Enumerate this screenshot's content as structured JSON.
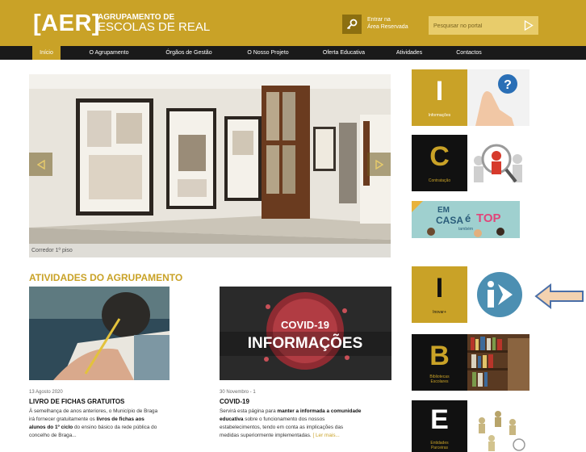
{
  "header": {
    "logo_mark": "[AER]",
    "logo_line1": "AGRUPAMENTO DE",
    "logo_line2": "ESCOLAS DE REAL",
    "reserved_line1": "Entrar na",
    "reserved_line2": "Área Reservada",
    "search_placeholder": "Pesquisar no portal",
    "colors": {
      "brand": "#c9a227",
      "nav": "#1a1a1a"
    }
  },
  "nav": {
    "items": [
      {
        "label": "Início",
        "active": true
      },
      {
        "label": "O Agrupamento"
      },
      {
        "label": "Órgãos de Gestão"
      },
      {
        "label": "O Nosso Projeto"
      },
      {
        "label": "Oferta Educativa"
      },
      {
        "label": "Atividades"
      },
      {
        "label": "Contactos"
      }
    ]
  },
  "slider": {
    "caption": "Corredor 1º piso"
  },
  "activities": {
    "title": "ATIVIDADES DO AGRUPAMENTO",
    "items": [
      {
        "date": "13 Agosto 2020",
        "title": "LIVRO DE FICHAS GRATUITOS",
        "text_a": "À semelhança de anos anteriores, o Município de Braga",
        "text_b": "irá fornecer gratuitamente os ",
        "text_b_bold": "livros de fichas aos",
        "text_c_bold": "alunos do 1º ciclo",
        "text_c": " do ensino básico da rede pública do",
        "text_d": "concelho de Braga..."
      },
      {
        "date": "30 Novembro - 1",
        "title": "COVID-19",
        "banner_line1": "COVID-19",
        "banner_line2": "INFORMAÇÕES",
        "text_a": "Servirá esta página para ",
        "text_a_bold": "manter a informada a comunidade",
        "text_b_bold": "educativa",
        "text_b": " sobre o funcionamento dos nossos",
        "text_c": "estabelecimentos, tendo em conta as implicações das",
        "text_d": "medidas superiormente implementadas. ",
        "more": "[ Ler mais..."
      }
    ]
  },
  "sidebar": {
    "tiles": [
      {
        "letter": "I",
        "label": "Informações"
      },
      {
        "letter": "C",
        "label": "Contratação"
      },
      {
        "banner_em": "EM",
        "banner_casa": "CASA",
        "banner_e": "é",
        "banner_top": "TOP",
        "banner_tambem": "também"
      },
      {
        "letter": "I",
        "label": "Inovar+"
      },
      {
        "letter": "B",
        "label1": "Bibliotecas",
        "label2": "Escolares"
      },
      {
        "letter": "E",
        "label1": "Entidades",
        "label2": "Parceiras"
      }
    ]
  }
}
